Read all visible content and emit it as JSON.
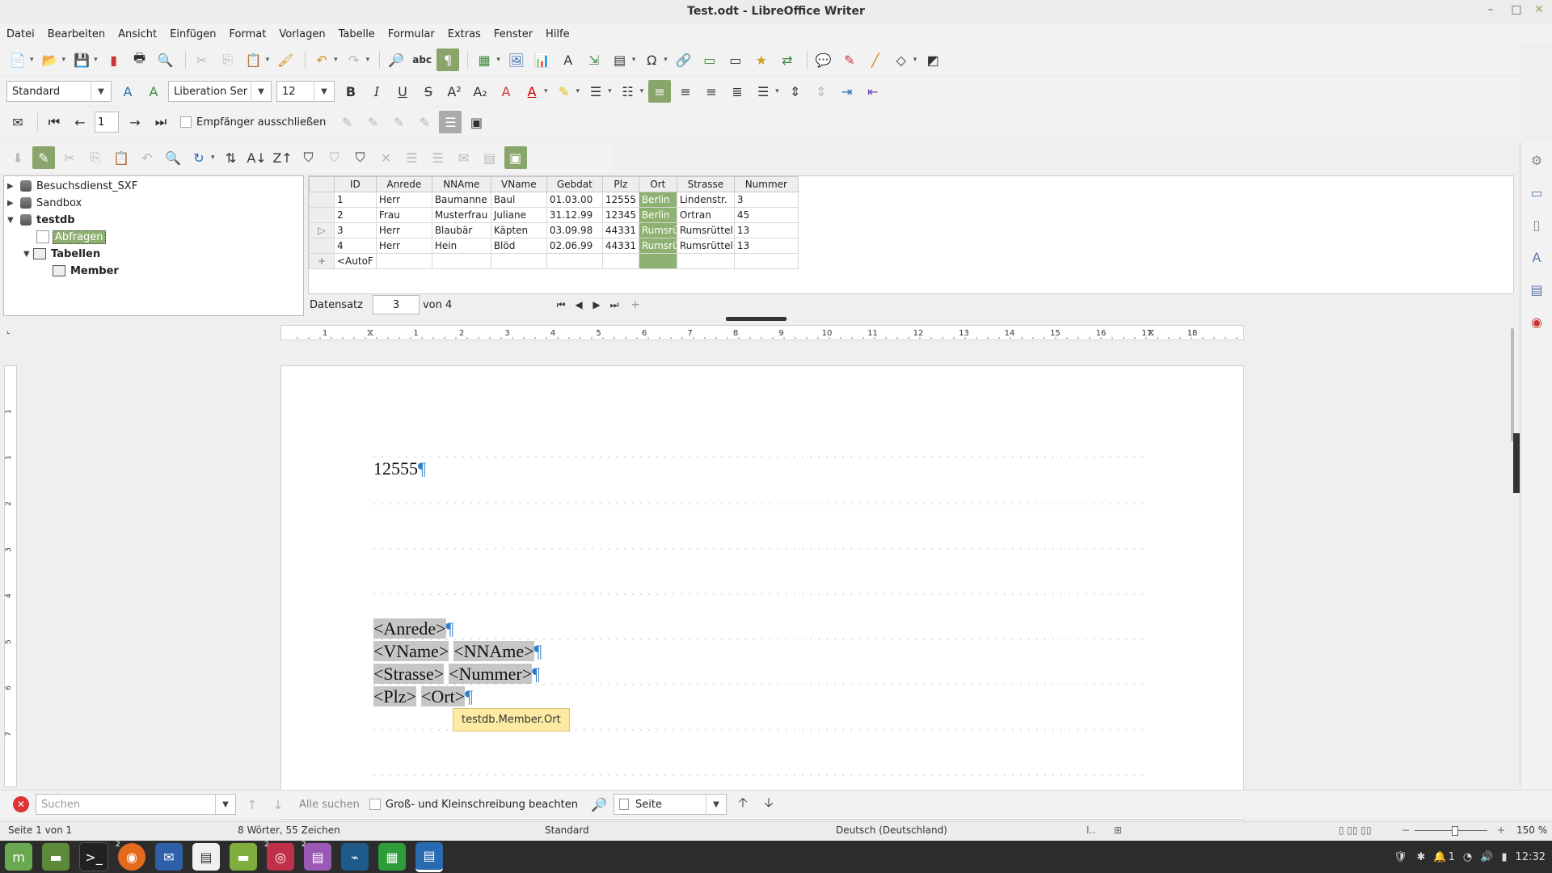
{
  "window": {
    "title": "Test.odt - LibreOffice Writer",
    "minimize": "–",
    "maximize": "□",
    "close": "✕"
  },
  "menu": [
    "Datei",
    "Bearbeiten",
    "Ansicht",
    "Einfügen",
    "Format",
    "Vorlagen",
    "Tabelle",
    "Formular",
    "Extras",
    "Fenster",
    "Hilfe"
  ],
  "format_toolbar": {
    "paragraph_style": "Standard",
    "font_name": "Liberation Ser",
    "font_size": "12"
  },
  "mailmerge_toolbar": {
    "record_input": "1",
    "exclude_label": "Empfänger ausschließen"
  },
  "db_tree": {
    "items": [
      {
        "label": "Besuchsdienst_SXF",
        "expanded": false
      },
      {
        "label": "Sandbox",
        "expanded": false
      },
      {
        "label": "testdb",
        "expanded": true
      },
      {
        "label": "Abfragen"
      },
      {
        "label": "Tabellen"
      },
      {
        "label": "Member"
      }
    ]
  },
  "db_grid": {
    "columns": [
      "ID",
      "Anrede",
      "NNAme",
      "VName",
      "Gebdat",
      "Plz",
      "Ort",
      "Strasse",
      "Nummer"
    ],
    "rows": [
      [
        "1",
        "Herr",
        "Baumanne",
        "Baul",
        "01.03.00",
        "12555",
        "Berlin",
        "Lindenstr.",
        "3"
      ],
      [
        "2",
        "Frau",
        "Musterfrau",
        "Juliane",
        "31.12.99",
        "12345",
        "Berlin",
        "Ortran",
        "45"
      ],
      [
        "3",
        "Herr",
        "Blaubär",
        "Käpten",
        "03.09.98",
        "44331",
        "Rumsrü",
        "Rumsrüttelk",
        "13"
      ],
      [
        "4",
        "Herr",
        "Hein",
        "Blöd",
        "02.06.99",
        "44331",
        "Rumsrü",
        "Rumsrüttelk",
        "13"
      ]
    ],
    "new_row_text": "<AutoF",
    "current_row_marker": "▷",
    "new_row_marker": "+"
  },
  "record_nav": {
    "label": "Datensatz",
    "current": "3",
    "of_text": "von 4"
  },
  "ruler_numbers": [
    "1",
    "1",
    "2",
    "3",
    "4",
    "5",
    "6",
    "7",
    "8",
    "9",
    "10",
    "11",
    "12",
    "13",
    "14",
    "15",
    "16",
    "17",
    "18"
  ],
  "vruler_numbers": [
    "1",
    "1",
    "2",
    "3",
    "4",
    "5",
    "6",
    "7"
  ],
  "document": {
    "line1": "12555",
    "pilcrow": "¶",
    "fields": {
      "anrede": "<Anrede>",
      "vname": "<VName>",
      "nname": "<NNAme>",
      "strasse": "<Strasse>",
      "nummer": "<Nummer>",
      "plz": "<Plz>",
      "ort": "<Ort>"
    },
    "tooltip": "testdb.Member.Ort"
  },
  "findbar": {
    "search_placeholder": "Suchen",
    "find_all": "Alle suchen",
    "match_case": "Groß- und Kleinschreibung beachten",
    "scope": "Seite"
  },
  "statusbar": {
    "page": "Seite 1 von 1",
    "words": "8 Wörter, 55 Zeichen",
    "style": "Standard",
    "language": "Deutsch (Deutschland)",
    "zoom": "150 %"
  },
  "taskbar": {
    "clock": "12:32",
    "workspace": "1"
  },
  "colors": {
    "accent_green": "#8eb070",
    "pilcrow_blue": "#2f7fd0",
    "tooltip_bg": "#fdeaa3"
  }
}
